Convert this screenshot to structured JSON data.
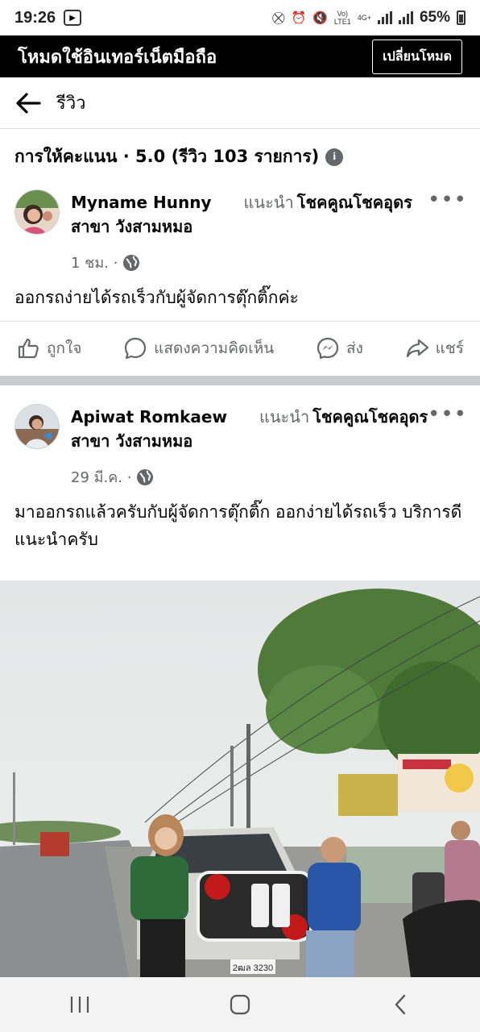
{
  "status_bar": {
    "time": "19:26",
    "network_label_top": "Vo)",
    "network_label_bottom": "LTE1",
    "network_type": "4G+",
    "battery": "65%"
  },
  "mode_banner": {
    "title": "โหมดใช้อินเทอร์เน็ตมือถือ",
    "button_label": "เปลี่ยนโหมด"
  },
  "header": {
    "title": "รีวิว"
  },
  "rating": {
    "summary": "การให้คะแนน · 5.0 (รีวิว 103 รายการ)"
  },
  "reviews": [
    {
      "author": "Myname Hunny",
      "recommend_label": "แนะนำ",
      "page_name": "โชคคูณโชคอุดร สาขา วังสามหมอ",
      "time": "1 ชม. ·",
      "text": "ออกรถง่ายได้รถเร็วกับผู้จัดการตุ๊กติ๊กค่ะ",
      "actions": {
        "like": "ถูกใจ",
        "comment": "แสดงความคิดเห็น",
        "send": "ส่ง",
        "share": "แชร์"
      }
    },
    {
      "author": "Apiwat Romkaew",
      "recommend_label": "แนะนำ",
      "page_name": "โชคคูณโชคอุดร สาขา วังสามหมอ",
      "time": "29 มี.ค. ·",
      "text": "มาออกรถแล้วครับกับผู้จัดการตุ๊กติ๊ก ออกง่ายได้รถเร็ว บริการดีแนะนำครับ"
    }
  ],
  "photo": {
    "plate_text": "2ฒล 3230"
  },
  "colors": {
    "banner_bg": "#000000",
    "text_primary": "#050505",
    "text_secondary": "#65676b",
    "divider": "#c9ccd1"
  }
}
